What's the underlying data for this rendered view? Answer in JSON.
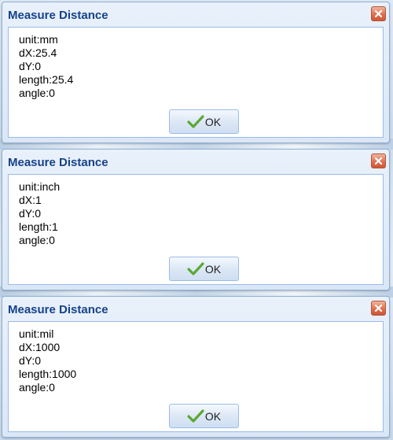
{
  "dialogs": [
    {
      "title": "Measure Distance",
      "lines": [
        "unit:mm",
        "dX:25.4",
        "dY:0",
        "length:25.4",
        "angle:0"
      ],
      "ok_label": "OK"
    },
    {
      "title": "Measure Distance",
      "lines": [
        "unit:inch",
        "dX:1",
        "dY:0",
        "length:1",
        "angle:0"
      ],
      "ok_label": "OK"
    },
    {
      "title": "Measure Distance",
      "lines": [
        "unit:mil",
        "dX:1000",
        "dY:0",
        "length:1000",
        "angle:0"
      ],
      "ok_label": "OK"
    }
  ],
  "icons": {
    "close": "close-icon",
    "ok": "checkmark-icon"
  },
  "colors": {
    "title_text": "#15428b",
    "close_button": "#e06f4f",
    "checkmark": "#5aa832",
    "border": "#99bbe8"
  }
}
